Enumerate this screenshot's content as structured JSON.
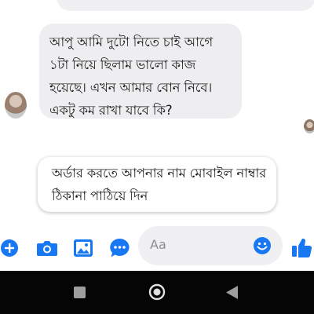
{
  "messages": {
    "received_text": "আপু আমি দুটো নিতে চাই আগে ১টা নিয়ে ছিলাম ভালো কাজ হয়েছে। এখন আমার বোন নিবে। একটু কম রাখা যাবে কি?",
    "reply_text": "অর্ডার করতে আপনার নাম মোবাইল নাম্বার ঠিকানা পাঠিয়ে দিন"
  },
  "composer": {
    "placeholder": "Aa",
    "icons": [
      "plus-icon",
      "camera-icon",
      "image-icon",
      "chat-bubble-icon",
      "emoji-icon",
      "thumbs-up-icon"
    ],
    "accent_color": "#1877f2"
  },
  "nav": {
    "icons": [
      "recents-icon",
      "home-icon",
      "back-icon"
    ]
  }
}
